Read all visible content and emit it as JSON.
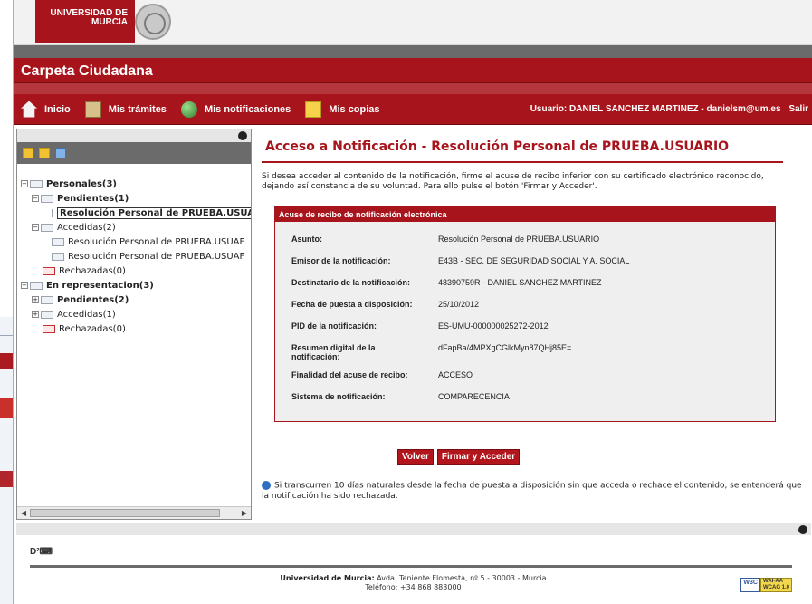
{
  "brand": {
    "university_line1": "UNIVERSIDAD DE",
    "university_line2": "MURCIA",
    "app_title": "Carpeta Ciudadana"
  },
  "nav": {
    "items": [
      {
        "label": "Inicio",
        "icon": "home-icon"
      },
      {
        "label": "Mis trámites",
        "icon": "documents-icon"
      },
      {
        "label": "Mis notificaciones",
        "icon": "globe-icon"
      },
      {
        "label": "Mis copias",
        "icon": "copies-icon"
      }
    ],
    "user_label": "Usuario: DANIEL SANCHEZ MARTINEZ - danielsm@um.es",
    "logout": "Salir"
  },
  "tree": {
    "personales": "Personales(3)",
    "pendientes": "Pendientes(1)",
    "pend_item": "Resolución Personal de PRUEBA.USUA",
    "accedidas": "Accedidas(2)",
    "acc_item1": "Resolución Personal de PRUEBA.USUAF",
    "acc_item2": "Resolución Personal de PRUEBA.USUAF",
    "rechazadas": "Rechazadas(0)",
    "representacion": "En representacion(3)",
    "rep_pendientes": "Pendientes(2)",
    "rep_accedidas": "Accedidas(1)",
    "rep_rechazadas": "Rechazadas(0)"
  },
  "main": {
    "title": "Acceso a Notificación - Resolución Personal de PRUEBA.USUARIO",
    "intro": "Si desea acceder al contenido de la notificación, firme el acuse de recibo inferior con su certificado electrónico reconocido, dejando así constancia de su voluntad. Para ello pulse el botón 'Firmar y Acceder'.",
    "card_title": "Acuse de recibo de notificación electrónica",
    "rows": [
      {
        "label": "Asunto:",
        "value": "Resolución Personal de PRUEBA.USUARIO"
      },
      {
        "label": "Emisor de la notificación:",
        "value": "E43B - SEC. DE SEGURIDAD SOCIAL Y A. SOCIAL"
      },
      {
        "label": "Destinatario de la notificación:",
        "value": "48390759R - DANIEL SANCHEZ MARTINEZ"
      },
      {
        "label": "Fecha de puesta a disposición:",
        "value": "25/10/2012"
      },
      {
        "label": "PID de la notificación:",
        "value": "ES-UMU-000000025272-2012"
      },
      {
        "label": "Resumen digital de la notificación:",
        "value": "dFapBa/4MPXgCGlkMyn87QHj85E="
      },
      {
        "label": "Finalidad del acuse de recibo:",
        "value": "ACCESO"
      },
      {
        "label": "Sistema de notificación:",
        "value": "COMPARECENCIA"
      }
    ],
    "btn_back": "Volver",
    "btn_sign": "Firmar y Acceder",
    "note": "Si transcurren 10 días naturales desde la fecha de puesta a disposición sin que acceda o rechace el contenido, se entenderá que la notificación ha sido rechazada."
  },
  "footer": {
    "org": "Universidad de Murcia:",
    "address": "Avda. Teniente Flomesta, nº 5 - 30003 - Murcia",
    "phone": "Teléfono: +34 868 883000",
    "w3c": "W3C",
    "wai_line1": "WAI-AA",
    "wai_line2": "WCAG 1.0"
  }
}
